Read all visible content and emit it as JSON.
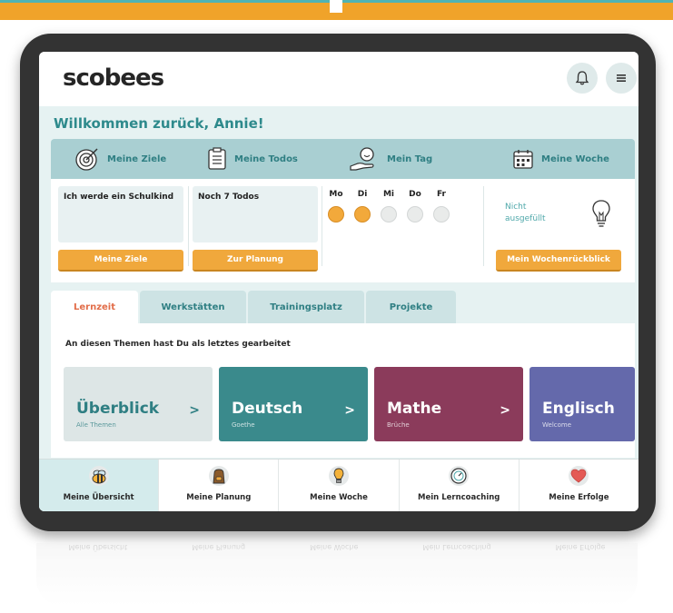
{
  "app": {
    "logo": "scobees"
  },
  "header": {
    "bell_icon": "bell-icon",
    "menu_icon": "hamburger-menu-icon"
  },
  "welcome": "Willkommen zurück, Annie!",
  "nav": [
    {
      "label": "Meine Ziele",
      "icon": "target-icon"
    },
    {
      "label": "Meine Todos",
      "icon": "checklist-icon"
    },
    {
      "label": "Mein Tag",
      "icon": "hand-sun-icon"
    },
    {
      "label": "Meine Woche",
      "icon": "calendar-icon"
    }
  ],
  "cards": {
    "ziele": {
      "text": "Ich werde ein Schulkind",
      "button": "Meine Ziele"
    },
    "todos": {
      "text": "Noch 7 Todos",
      "button": "Zur Planung"
    },
    "days": [
      {
        "label": "Mo",
        "filled": true
      },
      {
        "label": "Di",
        "filled": true
      },
      {
        "label": "Mi",
        "filled": false
      },
      {
        "label": "Do",
        "filled": false
      },
      {
        "label": "Fr",
        "filled": false
      }
    ],
    "woche": {
      "status": "Nicht ausgefüllt",
      "button": "Mein Wochenrückblick"
    }
  },
  "tabs": [
    {
      "label": "Lernzeit",
      "active": true
    },
    {
      "label": "Werkstätten",
      "active": false
    },
    {
      "label": "Trainingsplatz",
      "active": false
    },
    {
      "label": "Projekte",
      "active": false
    }
  ],
  "themen_heading": "An diesen Themen hast Du als letztes gearbeitet",
  "subjects": [
    {
      "name": "Überblick",
      "sub": "Alle Themen",
      "color": "#dde6e6",
      "text_color": "#2f7f83",
      "chevron": ">"
    },
    {
      "name": "Deutsch",
      "sub": "Goethe",
      "color": "#3a8a8c",
      "text_color": "#ffffff",
      "chevron": ">"
    },
    {
      "name": "Mathe",
      "sub": "Brüche",
      "color": "#8b3b5b",
      "text_color": "#ffffff",
      "chevron": ">"
    },
    {
      "name": "Englisch",
      "sub": "Welcome",
      "color": "#6469ab",
      "text_color": "#ffffff",
      "chevron": ""
    }
  ],
  "bottom_nav": [
    {
      "label": "Meine Übersicht",
      "icon": "bee-icon",
      "active": true
    },
    {
      "label": "Meine Planung",
      "icon": "backpack-icon",
      "active": false
    },
    {
      "label": "Meine Woche",
      "icon": "lightbulb-icon",
      "active": false
    },
    {
      "label": "Mein Lerncoaching",
      "icon": "gauge-icon",
      "active": false
    },
    {
      "label": "Meine Erfolge",
      "icon": "heart-icon",
      "active": false
    }
  ]
}
